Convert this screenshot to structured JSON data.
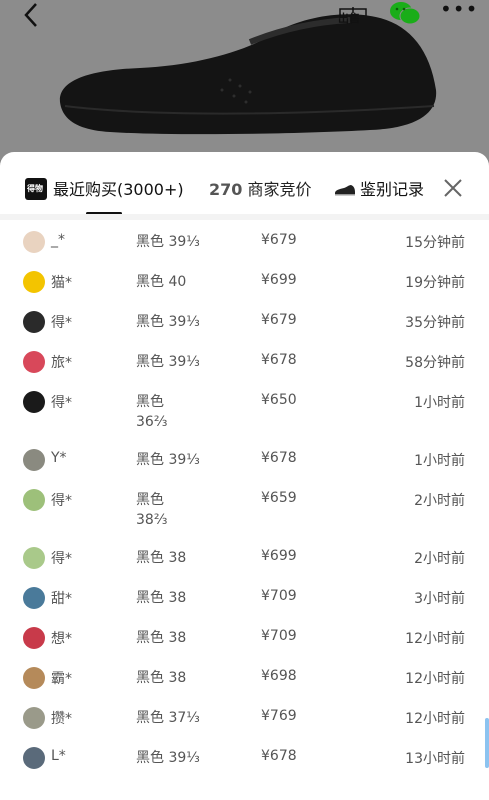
{
  "top_bar": {
    "sell_label": "出售"
  },
  "tabs": {
    "recent": {
      "logo_text": "得物",
      "label": "最近购买(3000+)"
    },
    "bids": {
      "count": "270",
      "label": "商家竞价"
    },
    "auth": {
      "label": "鉴别记录"
    }
  },
  "purchases": [
    {
      "name": "_*",
      "spec": "黑色 39⅓",
      "price": "¥679",
      "time": "15分钟前",
      "avatar_color": "#e9d3c0"
    },
    {
      "name": "猫*",
      "spec": "黑色 40",
      "price": "¥699",
      "time": "19分钟前",
      "avatar_color": "#f3c400"
    },
    {
      "name": "得*",
      "spec": "黑色 39⅓",
      "price": "¥679",
      "time": "35分钟前",
      "avatar_color": "#2a2a2a"
    },
    {
      "name": "旅*",
      "spec": "黑色 39⅓",
      "price": "¥678",
      "time": "58分钟前",
      "avatar_color": "#d8485a"
    },
    {
      "name": "得*",
      "spec": "黑色 36⅔",
      "spec_line1": "黑色",
      "spec_line2": "36⅔",
      "price": "¥650",
      "time": "1小时前",
      "avatar_color": "#1a1a1a"
    },
    {
      "name": "Y*",
      "spec": "黑色 39⅓",
      "price": "¥678",
      "time": "1小时前",
      "avatar_color": "#8a8a80"
    },
    {
      "name": "得*",
      "spec": "黑色 38⅔",
      "spec_line1": "黑色",
      "spec_line2": "38⅔",
      "price": "¥659",
      "time": "2小时前",
      "avatar_color": "#9dc07a"
    },
    {
      "name": "得*",
      "spec": "黑色 38",
      "price": "¥699",
      "time": "2小时前",
      "avatar_color": "#a9c98a"
    },
    {
      "name": "甜*",
      "spec": "黑色 38",
      "price": "¥709",
      "time": "3小时前",
      "avatar_color": "#4a7a9a"
    },
    {
      "name": "想*",
      "spec": "黑色 38",
      "price": "¥709",
      "time": "12小时前",
      "avatar_color": "#c83a4a"
    },
    {
      "name": "霸*",
      "spec": "黑色 38",
      "price": "¥698",
      "time": "12小时前",
      "avatar_color": "#b58a5a"
    },
    {
      "name": "攒*",
      "spec": "黑色 37⅓",
      "price": "¥769",
      "time": "12小时前",
      "avatar_color": "#9a9a8a"
    },
    {
      "name": "L*",
      "spec": "黑色 39⅓",
      "price": "¥678",
      "time": "13小时前",
      "avatar_color": "#5a6a7a"
    }
  ]
}
